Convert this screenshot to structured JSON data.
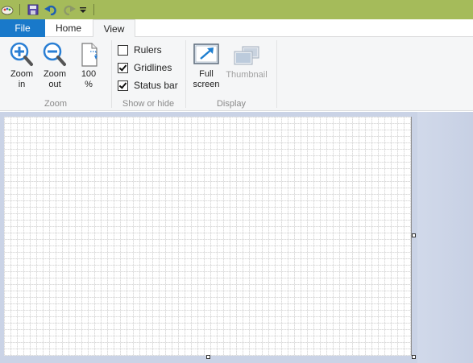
{
  "quick_access": {
    "icons": [
      "paint-app-icon",
      "save-icon",
      "undo-icon",
      "redo-icon",
      "customize-dropdown-icon"
    ]
  },
  "tabs": {
    "file": "File",
    "home": "Home",
    "view": "View",
    "active": "View"
  },
  "ribbon": {
    "zoom_group": {
      "label": "Zoom",
      "zoom_in": "Zoom\nin",
      "zoom_out": "Zoom\nout",
      "hundred": "100\n%"
    },
    "show_group": {
      "label": "Show or hide",
      "rulers": {
        "label": "Rulers",
        "checked": false
      },
      "gridlines": {
        "label": "Gridlines",
        "checked": true
      },
      "status_bar": {
        "label": "Status bar",
        "checked": true
      }
    },
    "display_group": {
      "label": "Display",
      "full_screen": "Full\nscreen",
      "thumbnail": "Thumbnail",
      "thumbnail_enabled": false
    }
  },
  "colors": {
    "title_bar": "#a5bb5a",
    "file_tab": "#1979ca",
    "ribbon_bg": "#f5f6f7",
    "workspace": "#cad3e6",
    "zoom_icon": "#2a7fd4"
  }
}
